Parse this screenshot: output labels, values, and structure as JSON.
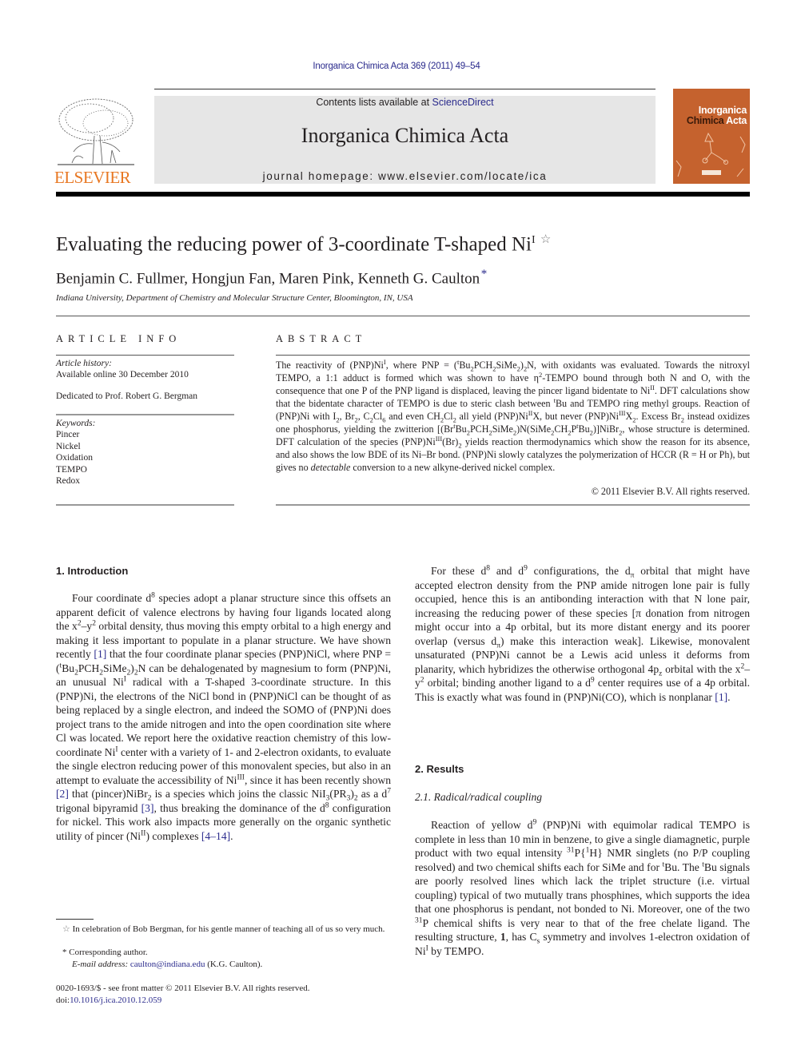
{
  "header": {
    "citation": "Inorganica Chimica Acta 369 (2011) 49–54",
    "contents_prefix": "Contents lists available at ",
    "contents_link": "ScienceDirect",
    "journal_name": "Inorganica Chimica Acta",
    "homepage": "journal homepage: www.elsevier.com/locate/ica",
    "publisher_logo_text": "ELSEVIER",
    "cover_title_line1": "Inorganica",
    "cover_title_line2a": "Chimica",
    "cover_title_line2b": " Acta",
    "colors": {
      "elsevier_orange": "#e87722",
      "cover_orange": "#c5622e",
      "link_blue": "#2a2a8c",
      "masthead_gray": "#e6e6e6"
    }
  },
  "article": {
    "title": "Evaluating the reducing power of 3-coordinate T-shaped Ni",
    "title_superscript": "I",
    "title_note_symbol": "☆",
    "authors": "Benjamin C. Fullmer, Hongjun Fan, Maren Pink, Kenneth G. Caulton",
    "corresponding_symbol": "*",
    "affiliation": "Indiana University, Department of Chemistry and Molecular Structure Center, Bloomington, IN, USA"
  },
  "article_info": {
    "heading": "ARTICLE INFO",
    "history_label": "Article history:",
    "history_value": "Available online 30 December 2010",
    "dedication": "Dedicated to Prof. Robert G. Bergman",
    "keywords_label": "Keywords:",
    "keywords": [
      "Pincer",
      "Nickel",
      "Oxidation",
      "TEMPO",
      "Redox"
    ]
  },
  "abstract": {
    "heading": "ABSTRACT",
    "copyright": "© 2011 Elsevier B.V. All rights reserved."
  },
  "sections": {
    "intro_heading": "1. Introduction",
    "results_heading": "2. Results",
    "subsection_heading": "2.1. Radical/radical coupling"
  },
  "footnotes": {
    "star_note": "In celebration of Bob Bergman, for his gentle manner of teaching all of us so very much.",
    "corresponding": "Corresponding author.",
    "email_label": "E-mail address:",
    "email": "caulton@indiana.edu",
    "email_suffix": " (K.G. Caulton).",
    "front_matter": "0020-1693/$ - see front matter © 2011 Elsevier B.V. All rights reserved.",
    "doi_label": "doi:",
    "doi": "10.1016/j.ica.2010.12.059"
  }
}
